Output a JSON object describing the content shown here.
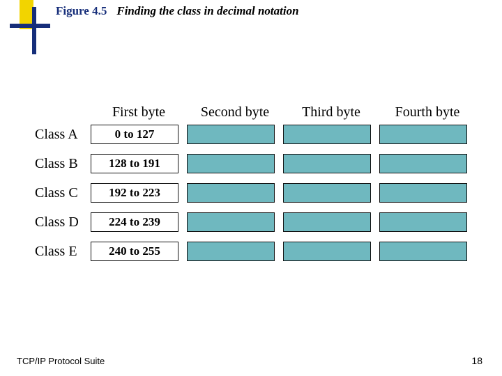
{
  "figure": {
    "number": "Figure 4.5",
    "caption": "Finding the class in decimal notation"
  },
  "headers": [
    "First byte",
    "Second byte",
    "Third byte",
    "Fourth byte"
  ],
  "rows": [
    {
      "label": "Class A",
      "range": "0 to 127"
    },
    {
      "label": "Class B",
      "range": "128 to 191"
    },
    {
      "label": "Class C",
      "range": "192 to 223"
    },
    {
      "label": "Class D",
      "range": "224 to 239"
    },
    {
      "label": "Class E",
      "range": "240 to 255"
    }
  ],
  "footer": "TCP/IP Protocol Suite",
  "page": "18",
  "colors": {
    "accent_yellow": "#f2d400",
    "accent_navy": "#162e7a",
    "cell_teal": "#6fb8bf"
  }
}
